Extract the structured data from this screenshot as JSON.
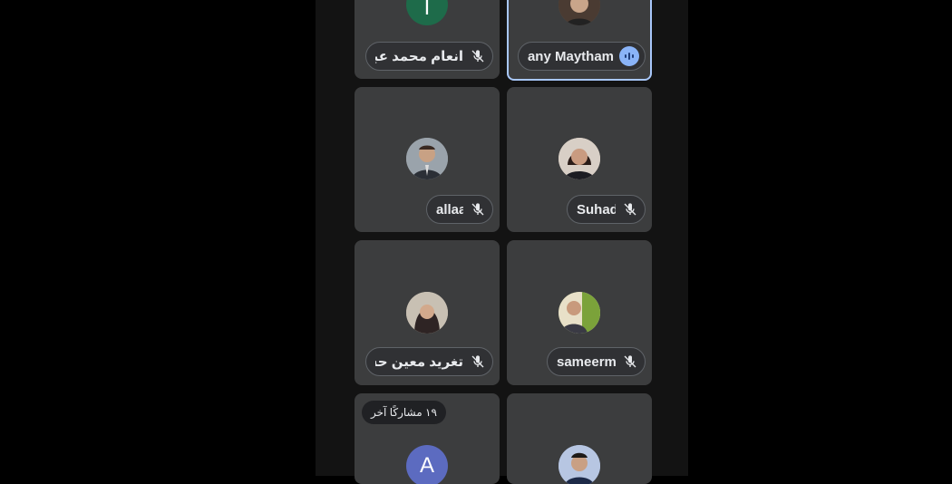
{
  "participants": [
    {
      "name": "انعام محمد عبد",
      "avatar_letter": "I",
      "avatar_color": "#1e6b4a"
    },
    {
      "name": "Shany Maytham",
      "speaking": true
    },
    {
      "name": "allaa"
    },
    {
      "name": "Suhad"
    },
    {
      "name": "تغريد معين حسن"
    },
    {
      "name": "sameerm"
    },
    {
      "avatar_letter": "A",
      "avatar_color": "#5c6bc0"
    },
    {}
  ],
  "others_label": "١٩ مشاركًا آخر",
  "colors": {
    "tile": "#3c3d3e",
    "active_border": "#a8c7fa",
    "speak_indicator": "#8ab4f8"
  }
}
